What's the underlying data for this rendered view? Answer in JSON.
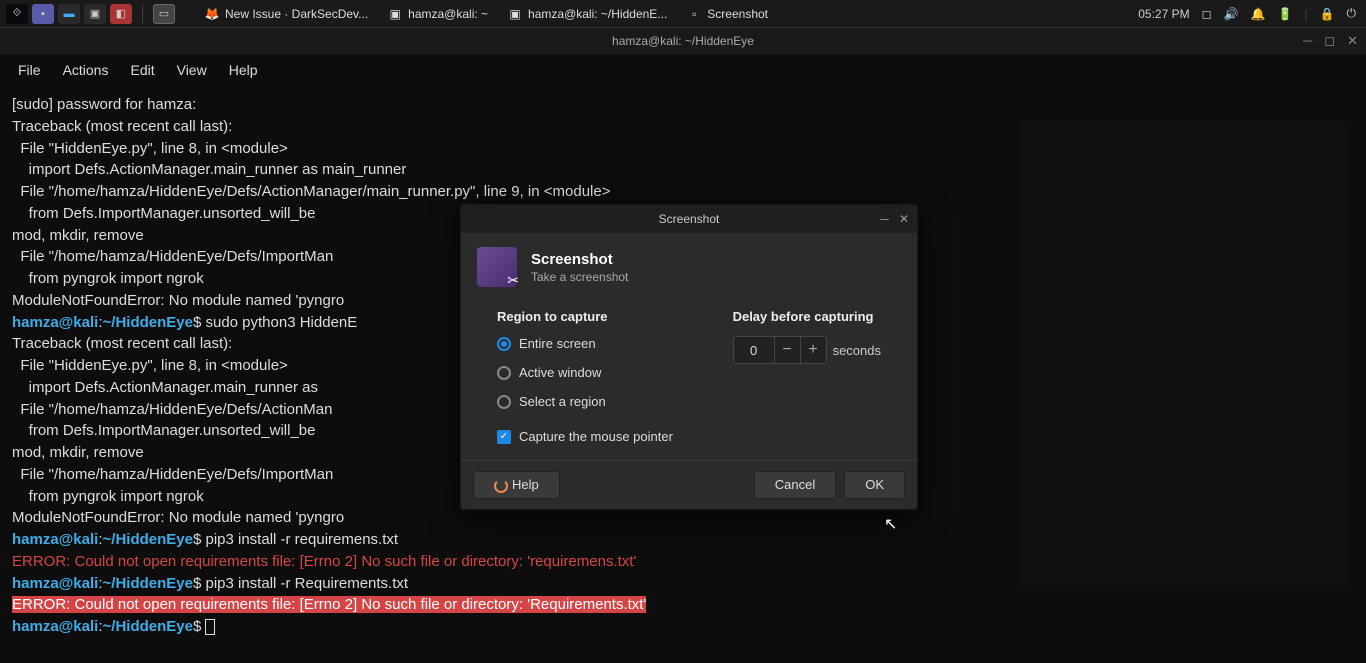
{
  "topbar": {
    "tasks": [
      {
        "icon": "🦊",
        "label": "New Issue · DarkSecDev..."
      },
      {
        "icon": "▣",
        "label": "hamza@kali: ~"
      },
      {
        "icon": "▣",
        "label": "hamza@kali: ~/HiddenE..."
      },
      {
        "icon": "▫",
        "label": "Screenshot"
      }
    ],
    "time": "05:27 PM"
  },
  "window": {
    "title": "hamza@kali: ~/HiddenEye",
    "menus": [
      "File",
      "Actions",
      "Edit",
      "View",
      "Help"
    ]
  },
  "terminal": {
    "lines": [
      {
        "t": "plain",
        "txt": "[sudo] password for hamza:"
      },
      {
        "t": "plain",
        "txt": "Traceback (most recent call last):"
      },
      {
        "t": "plain",
        "txt": "  File \"HiddenEye.py\", line 8, in <module>"
      },
      {
        "t": "plain",
        "txt": "    import Defs.ActionManager.main_runner as main_runner"
      },
      {
        "t": "plain",
        "txt": "  File \"/home/hamza/HiddenEye/Defs/ActionManager/main_runner.py\", line 9, in <module>"
      },
      {
        "t": "plain",
        "txt": "    from Defs.ImportManager.unsorted_will_be                                               , path, rmtree, pathlib_Path, copyfile, ch"
      },
      {
        "t": "plain",
        "txt": "mod, mkdir, remove"
      },
      {
        "t": "plain",
        "txt": "  File \"/home/hamza/HiddenEye/Defs/ImportMan                                               <module>"
      },
      {
        "t": "plain",
        "txt": "    from pyngrok import ngrok"
      },
      {
        "t": "plain",
        "txt": "ModuleNotFoundError: No module named 'pyngro"
      },
      {
        "t": "prompt",
        "cmd": "sudo python3 HiddenE"
      },
      {
        "t": "plain",
        "txt": "Traceback (most recent call last):"
      },
      {
        "t": "plain",
        "txt": "  File \"HiddenEye.py\", line 8, in <module>"
      },
      {
        "t": "plain",
        "txt": "    import Defs.ActionManager.main_runner as"
      },
      {
        "t": "plain",
        "txt": "  File \"/home/hamza/HiddenEye/Defs/ActionMan"
      },
      {
        "t": "plain",
        "txt": "    from Defs.ImportManager.unsorted_will_be                                               , path, rmtree, pathlib_Path, copyfile, ch"
      },
      {
        "t": "plain",
        "txt": "mod, mkdir, remove"
      },
      {
        "t": "plain",
        "txt": "  File \"/home/hamza/HiddenEye/Defs/ImportMan                                               <module>"
      },
      {
        "t": "plain",
        "txt": "    from pyngrok import ngrok"
      },
      {
        "t": "plain",
        "txt": "ModuleNotFoundError: No module named 'pyngro"
      },
      {
        "t": "prompt",
        "cmd": "pip3 install -r requiremens.txt"
      },
      {
        "t": "err",
        "txt": "ERROR: Could not open requirements file: [Errno 2] No such file or directory: 'requiremens.txt'"
      },
      {
        "t": "prompt",
        "cmd": "pip3 install -r Requirements.txt"
      },
      {
        "t": "errhl",
        "txt": "ERROR: Could not open requirements file: [Errno 2] No such file or directory: 'Requirements.txt'"
      },
      {
        "t": "prompt",
        "cmd": "",
        "cursor": true
      }
    ],
    "user": "hamza",
    "host": "kali",
    "path": "~/HiddenEye"
  },
  "dialog": {
    "winTitle": "Screenshot",
    "title": "Screenshot",
    "subtitle": "Take a screenshot",
    "regionLabel": "Region to capture",
    "delayLabel": "Delay before capturing",
    "options": {
      "entire": "Entire screen",
      "active": "Active window",
      "region": "Select a region"
    },
    "pointer": "Capture the mouse pointer",
    "delayVal": "0",
    "secondsLabel": "seconds",
    "help": "Help",
    "cancel": "Cancel",
    "ok": "OK"
  }
}
